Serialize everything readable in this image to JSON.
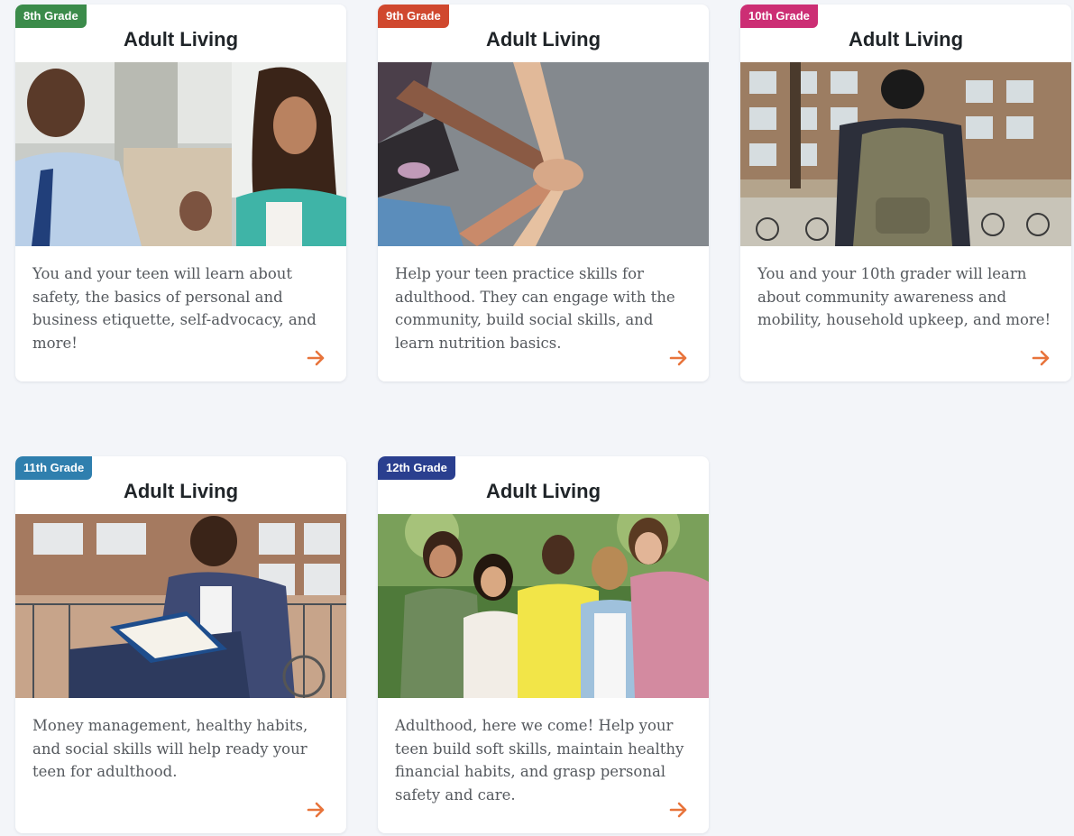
{
  "colors": {
    "page_background": "#f3f5f9",
    "arrow_accent": "#e8743b"
  },
  "cards": [
    {
      "grade": "8th Grade",
      "grade_color": "#3b8b4a",
      "title": "Adult Living",
      "image": "teacher-and-student-conversation",
      "description": "You and your teen will learn about safety, the basics of personal and business etiquette, self-advocacy, and more!",
      "link_icon": "arrow-right-icon"
    },
    {
      "grade": "9th Grade",
      "grade_color": "#d0482e",
      "title": "Adult Living",
      "image": "stacked-hands-teamwork",
      "description": "Help your teen practice skills for adulthood. They can engage with the community, build social skills, and learn nutrition basics.",
      "link_icon": "arrow-right-icon"
    },
    {
      "grade": "10th Grade",
      "grade_color": "#cc2e74",
      "title": "Adult Living",
      "image": "student-with-backpack-on-campus",
      "description": "You and your 10th grader will learn about community awareness and mobility, household upkeep, and more!",
      "link_icon": "arrow-right-icon"
    },
    {
      "grade": "11th Grade",
      "grade_color": "#2f7fae",
      "title": "Adult Living",
      "image": "teen-reading-book-in-wheelchair",
      "description": "Money management, healthy habits, and social skills will help ready your teen for adulthood.",
      "link_icon": "arrow-right-icon"
    },
    {
      "grade": "12th Grade",
      "grade_color": "#2a3f8f",
      "title": "Adult Living",
      "image": "group-of-smiling-teens-outdoors",
      "description": "Adulthood, here we come! Help your teen build soft skills, maintain healthy financial habits, and grasp personal safety and care.",
      "link_icon": "arrow-right-icon"
    }
  ]
}
